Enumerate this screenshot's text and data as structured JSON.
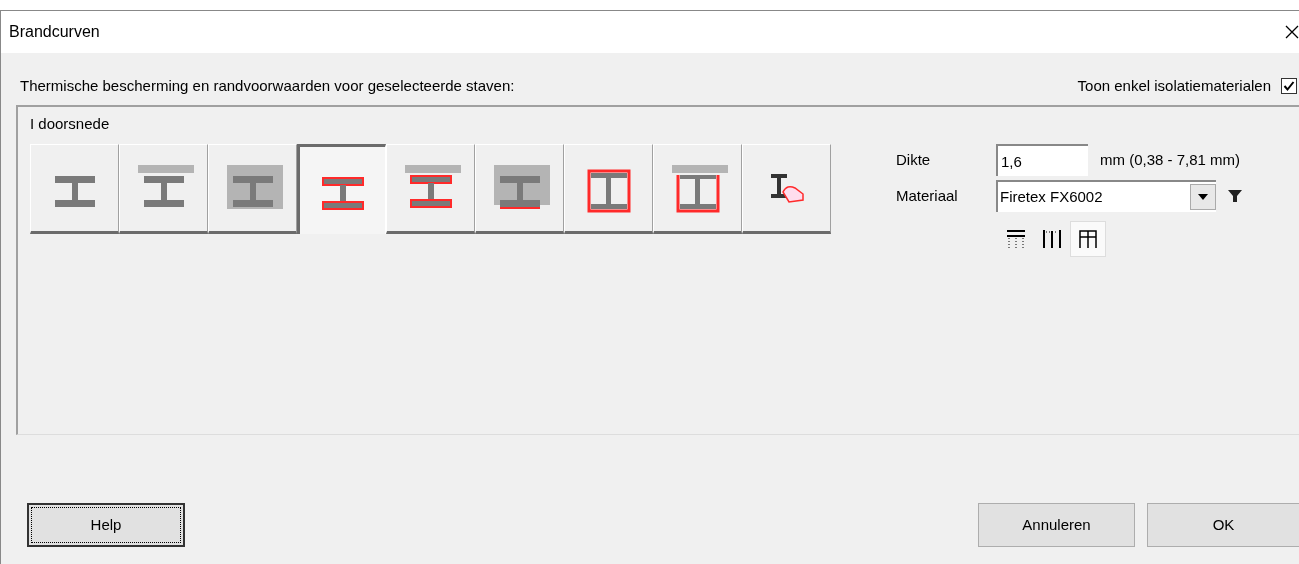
{
  "window": {
    "title": "Brandcurven"
  },
  "heading": "Thermische bescherming en randvoorwaarden voor geselecteerde staven:",
  "isolation_only": {
    "label": "Toon enkel isolatiematerialen",
    "checked": true
  },
  "group": {
    "title": "I doorsnede",
    "profiles": [
      {
        "kind": "i-plain",
        "selected": false
      },
      {
        "kind": "i-top-plate",
        "selected": false
      },
      {
        "kind": "i-boxed-gray",
        "selected": false
      },
      {
        "kind": "i-red",
        "selected": true
      },
      {
        "kind": "i-red-top-plate",
        "selected": false
      },
      {
        "kind": "i-boxed-red-bottom",
        "selected": false
      },
      {
        "kind": "box-red",
        "selected": false
      },
      {
        "kind": "box-red-top-plate",
        "selected": false
      },
      {
        "kind": "custom",
        "selected": false
      }
    ]
  },
  "thickness": {
    "label": "Dikte",
    "value": "1,6",
    "unit": "mm (0,38 - 7,81 mm)"
  },
  "material": {
    "label": "Materiaal",
    "value": "Firetex FX6002"
  },
  "exposure": [
    {
      "kind": "top",
      "selected": false
    },
    {
      "kind": "sides",
      "selected": false
    },
    {
      "kind": "all",
      "selected": true
    }
  ],
  "buttons": {
    "help": "Help",
    "cancel": "Annuleren",
    "ok": "OK"
  }
}
